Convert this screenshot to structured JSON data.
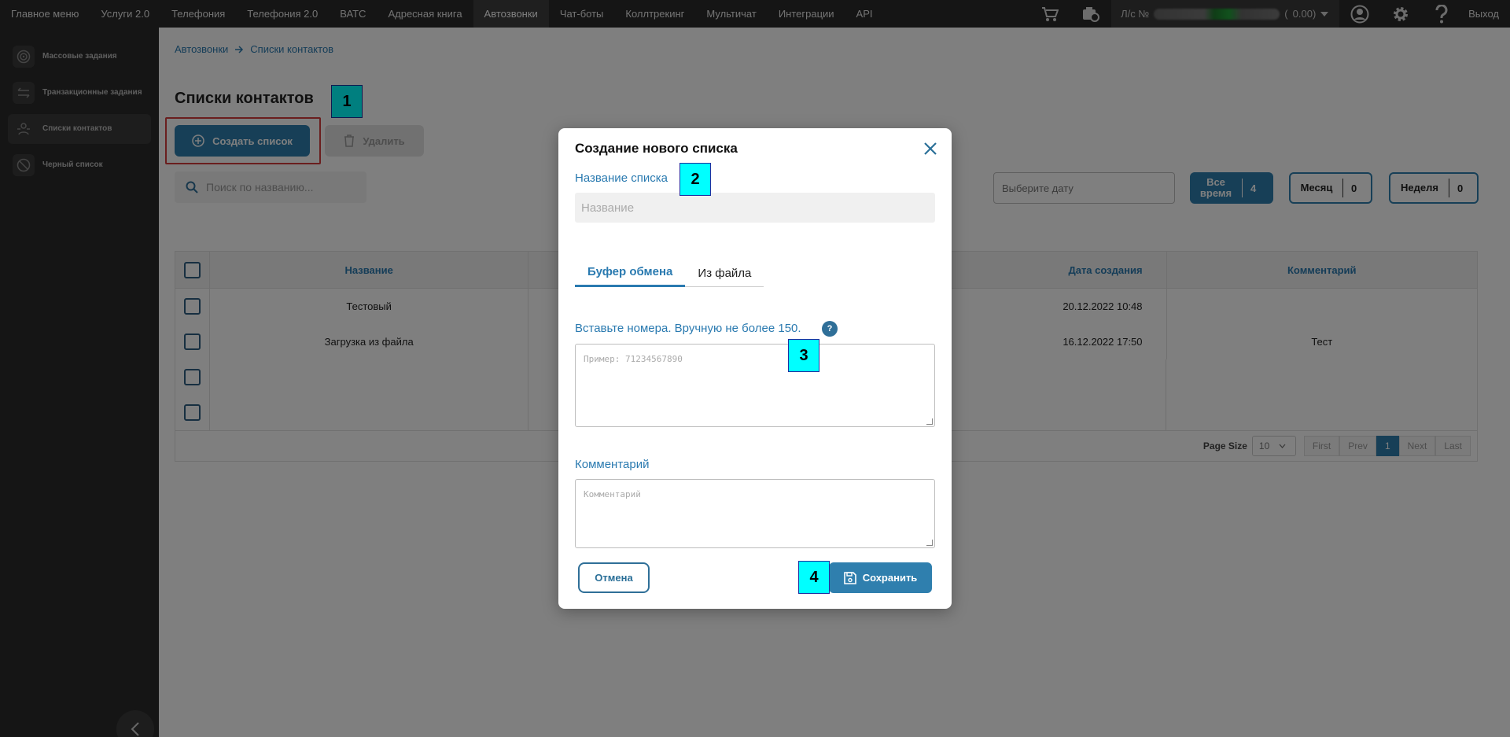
{
  "topnav": {
    "items": [
      "Главное меню",
      "Услуги 2.0",
      "Телефония",
      "Телефония 2.0",
      "ВАТС",
      "Адресная книга",
      "Автозвонки",
      "Чат-боты",
      "Коллтрекинг",
      "Мультичат",
      "Интеграции",
      "API"
    ],
    "active_index": 6,
    "account_prefix": "Л/с №",
    "account_open": "(",
    "account_suffix": "0.00)",
    "logout": "Выход",
    "icons": [
      "cart-icon",
      "wallet-icon",
      "user-icon",
      "gear-icon",
      "help-icon"
    ]
  },
  "sidebar": {
    "items": [
      {
        "label": "Массовые задания",
        "icon": "target-icon"
      },
      {
        "label": "Транзакционные задания",
        "icon": "arrows-icon"
      },
      {
        "label": "Списки контактов",
        "icon": "contacts-icon"
      },
      {
        "label": "Черный список",
        "icon": "block-icon"
      }
    ],
    "active_index": 2
  },
  "breadcrumb": {
    "root": "Автозвонки",
    "current": "Списки контактов"
  },
  "page_title": "Списки контактов",
  "toolbar": {
    "create_label": "Создать список",
    "delete_label": "Удалить"
  },
  "search": {
    "placeholder": "Поиск по названию..."
  },
  "date_filter": {
    "placeholder": "Выберите дату"
  },
  "period_filters": [
    {
      "label": "Все время",
      "count": "4",
      "active": true
    },
    {
      "label": "Месяц",
      "count": "0",
      "active": false
    },
    {
      "label": "Неделя",
      "count": "0",
      "active": false
    }
  ],
  "table": {
    "headers": {
      "name": "Название",
      "date": "Дата создания",
      "comment": "Комментарий"
    },
    "rows": [
      {
        "name": "Тестовый",
        "date": "20.12.2022 10:48",
        "comment": ""
      },
      {
        "name": "Загрузка из файла",
        "date": "16.12.2022 17:50",
        "comment": "Тест"
      },
      {
        "name": "",
        "date": "",
        "comment": ""
      },
      {
        "name": "",
        "date": "",
        "comment": ""
      }
    ],
    "pagination": {
      "page_size_label": "Page Size",
      "page_size": "10",
      "first": "First",
      "prev": "Prev",
      "current": "1",
      "next": "Next",
      "last": "Last"
    }
  },
  "modal": {
    "title": "Создание нового списка",
    "name_label": "Название списка",
    "name_placeholder": "Название",
    "tabs": [
      "Буфер обмена",
      "Из файла"
    ],
    "active_tab": 0,
    "numbers_label": "Вставьте номера. Вручную не более 150.",
    "help_mark": "?",
    "numbers_placeholder": "Пример: 71234567890",
    "comment_label": "Комментарий",
    "comment_placeholder": "Комментарий",
    "cancel_label": "Отмена",
    "save_label": "Сохранить"
  },
  "annotations": [
    "1",
    "2",
    "3",
    "4"
  ],
  "colors": {
    "accent": "#2f7fae",
    "nav_bg": "#2b2b2b",
    "annotation": "#00ffff",
    "highlight": "#d43c3c"
  }
}
